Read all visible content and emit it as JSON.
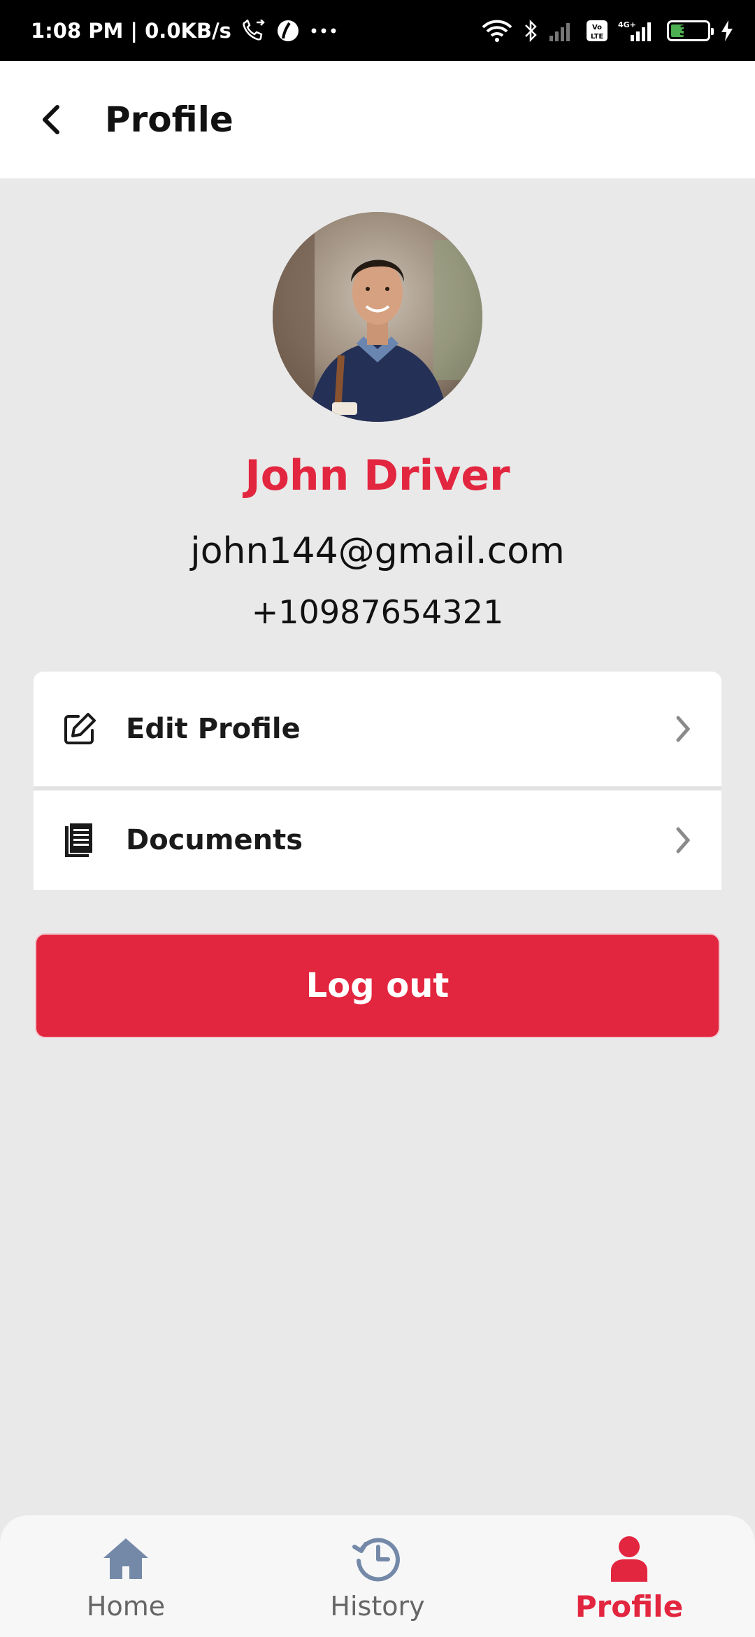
{
  "status_bar": {
    "time_network": "1:08 PM | 0.0KB/s",
    "battery_level": "32",
    "icons": [
      "call-forward-icon",
      "app-icon",
      "more-dots-icon",
      "wifi-icon",
      "bluetooth-icon",
      "signal-icon",
      "volte-icon",
      "4g-signal-icon",
      "battery-icon",
      "charging-icon"
    ]
  },
  "app_bar": {
    "title": "Profile"
  },
  "profile": {
    "name": "John Driver",
    "email": "john144@gmail.com",
    "phone": "+10987654321"
  },
  "menu": {
    "items": [
      {
        "label": "Edit Profile",
        "icon": "edit-icon"
      },
      {
        "label": "Documents",
        "icon": "documents-icon"
      }
    ]
  },
  "logout": {
    "label": "Log out"
  },
  "bottom_nav": {
    "items": [
      {
        "label": "Home",
        "icon": "home-icon",
        "active": false
      },
      {
        "label": "History",
        "icon": "history-icon",
        "active": false
      },
      {
        "label": "Profile",
        "icon": "profile-icon",
        "active": true
      }
    ]
  },
  "colors": {
    "accent": "#e3263f",
    "background": "#e9e9e9",
    "nav_inactive_icon": "#7489a8"
  }
}
